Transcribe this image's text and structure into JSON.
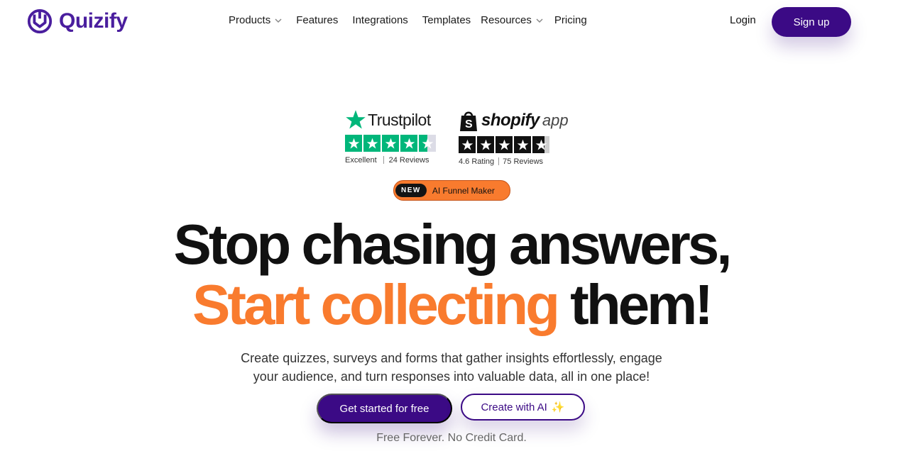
{
  "brand": {
    "name": "Quizify",
    "color": "#4a1e9e",
    "icon": "quizify-logo-icon"
  },
  "nav": {
    "items": [
      {
        "label": "Products",
        "has_dropdown": true
      },
      {
        "label": "Features",
        "has_dropdown": false
      },
      {
        "label": "Integrations",
        "has_dropdown": false
      },
      {
        "label": "Templates",
        "has_dropdown": false
      },
      {
        "label": "Resources",
        "has_dropdown": true
      },
      {
        "label": "Pricing",
        "has_dropdown": false
      }
    ],
    "login": "Login",
    "signup": "Sign up"
  },
  "ratings": {
    "trustpilot": {
      "brand": "Trustpilot",
      "label": "Excellent",
      "reviews": "24 Reviews",
      "star_color": "#00b67a",
      "stars": 4.5
    },
    "shopify": {
      "brand": "shopify",
      "suffix": "app",
      "label": "4.6 Rating",
      "reviews": "75 Reviews",
      "star_color": "#111111",
      "stars": 4.5
    }
  },
  "badge": {
    "tag": "NEW",
    "label": "AI Funnel Maker",
    "color": "#f97b2e"
  },
  "hero": {
    "line1": "Stop chasing answers,",
    "line2_highlight": "Start collecting",
    "line2_rest": "them!",
    "highlight_color": "#f97b2e",
    "subtitle_line1": "Create quizzes, surveys and forms that gather insights effortlessly, engage",
    "subtitle_line2": "your audience, and turn responses into valuable data, all in one place!",
    "cta_primary": "Get started for free",
    "cta_secondary": "Create with AI",
    "cta_secondary_icon": "sparkles-icon",
    "note": "Free Forever. No Credit Card."
  },
  "colors": {
    "primary": "#3b0a85"
  }
}
